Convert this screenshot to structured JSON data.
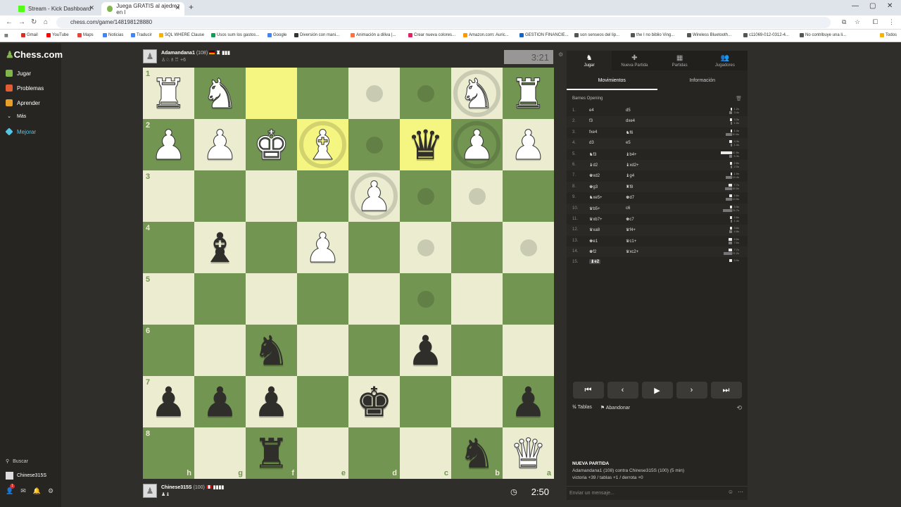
{
  "browser": {
    "tabs": [
      {
        "title": "Stream - Kick Dashboard"
      },
      {
        "title": "Juega GRATIS al ajedrez en l"
      }
    ],
    "url": "chess.com/game/148198128880",
    "bookmarks": [
      "Gmail",
      "YouTube",
      "Maps",
      "Noticias",
      "Traducir",
      "SQL WHERE Clause",
      "Usos sum los gastos...",
      "Google",
      "Diversión con mani...",
      "Animación a diliva |...",
      "Crear nueva colores...",
      "Amazon.com: Auric...",
      "GESTION FINANCIE...",
      "son senseos del lip...",
      "the I no biblio Ving...",
      "Wireless Bluetooth...",
      "c11069-012-0312-4...",
      "No contribuye una li...",
      "Todos"
    ]
  },
  "sidebar": {
    "logo": "Chess.com",
    "items": [
      "Jugar",
      "Problemas",
      "Aprender",
      "Más",
      "Mejorar"
    ],
    "colors": [
      "#81b64c",
      "#e25d33",
      "#e69f28",
      "#bbbbbb",
      "#54c6e3"
    ],
    "bottom": [
      "Buscar",
      "Chinese315S"
    ],
    "notif": "1"
  },
  "top_player": {
    "name": "Adamandana1",
    "rating": "(108)",
    "extra": "+6",
    "clock": "3:21"
  },
  "bottom_player": {
    "name": "Chinese315S",
    "rating": "(100)",
    "clock": "2:50"
  },
  "board": {
    "ranks": [
      "1",
      "2",
      "3",
      "4",
      "5",
      "6",
      "7",
      "8"
    ],
    "files": [
      "h",
      "g",
      "f",
      "e",
      "d",
      "c",
      "b",
      "a"
    ],
    "squares": [
      [
        "wR",
        "wN",
        "hl",
        "",
        "dot",
        "dot",
        "wN+ring",
        "wR"
      ],
      [
        "wP",
        "wP",
        "wK",
        "wB+hl+ring",
        "dot",
        "bQ+hl",
        "wP+ring",
        "wP"
      ],
      [
        "",
        "",
        "",
        "",
        "wP+ring",
        "dot",
        "dot",
        ""
      ],
      [
        "",
        "bB",
        "",
        "wP",
        "",
        "dot",
        "",
        "dot"
      ],
      [
        "",
        "",
        "",
        "",
        "",
        "dot",
        "",
        ""
      ],
      [
        "",
        "",
        "bN",
        "",
        "",
        "bP",
        "",
        ""
      ],
      [
        "bP",
        "bP",
        "bP",
        "",
        "bK",
        "",
        "",
        "bP"
      ],
      [
        "",
        "",
        "bR",
        "",
        "",
        "",
        "bN",
        "wQ"
      ]
    ]
  },
  "panel": {
    "tabs": [
      {
        "label": "Jugar",
        "icon": "♞"
      },
      {
        "label": "Nueva Partida",
        "icon": "✚"
      },
      {
        "label": "Partidas",
        "icon": "▦"
      },
      {
        "label": "Jugadores",
        "icon": "👥"
      }
    ],
    "subtabs": [
      "Movimientos",
      "Información"
    ],
    "opening": "Barnes Opening",
    "moves": [
      {
        "n": "1.",
        "w": "e4",
        "b": "d5",
        "t1": "1.2s",
        "t2": "3.4s",
        "p1": 2,
        "p2": 4
      },
      {
        "n": "2.",
        "w": "f3",
        "b": "dxe4",
        "t1": "3.3s",
        "t2": "1.5s",
        "p1": 3,
        "p2": 2
      },
      {
        "n": "3.",
        "w": "fxe4",
        "b": "♞f6",
        "t1": "1.4s",
        "t2": "10.6s",
        "p1": 2,
        "p2": 9
      },
      {
        "n": "4.",
        "w": "d3",
        "b": "e5",
        "t1": "4.3s",
        "t2": "1.4s",
        "p1": 4,
        "p2": 2
      },
      {
        "n": "5.",
        "w": "♞f3",
        "b": "♝b4+",
        "t1": "42.8s",
        "t2": "5.3s",
        "p1": 16,
        "p2": 4
      },
      {
        "n": "6.",
        "w": "♝d2",
        "b": "♝xd2+",
        "t1": "2.8s",
        "t2": "2.0s",
        "p1": 3,
        "p2": 2
      },
      {
        "n": "7.",
        "w": "♚xd2",
        "b": "♝g4",
        "t1": "1.9s",
        "t2": "13.4s",
        "p1": 2,
        "p2": 9
      },
      {
        "n": "8.",
        "w": "♚g3",
        "b": "♜f8",
        "t1": "7.7s",
        "t2": "16.0s",
        "p1": 5,
        "p2": 10
      },
      {
        "n": "9.",
        "w": "♞xe5+",
        "b": "♚d7",
        "t1": "5.8s",
        "t2": "13.5s",
        "p1": 4,
        "p2": 9
      },
      {
        "n": "10.",
        "w": "♛b5+",
        "b": "c6",
        "t1": "3.9s",
        "t2": "24.7s",
        "p1": 3,
        "p2": 13
      },
      {
        "n": "11.",
        "w": "♛xb7+",
        "b": "♚c7",
        "t1": "2.6s",
        "t2": "1.4s",
        "p1": 3,
        "p2": 2
      },
      {
        "n": "12.",
        "w": "♛xa8",
        "b": "♛f4+",
        "t1": "3.6s",
        "t2": "4.8s",
        "p1": 3,
        "p2": 4
      },
      {
        "n": "13.",
        "w": "♚e1",
        "b": "♛c1+",
        "t1": "8.8s",
        "t2": "7.6s",
        "p1": 5,
        "p2": 5
      },
      {
        "n": "14.",
        "w": "♚f2",
        "b": "♛xc2+",
        "t1": "7.7s",
        "t2": "21.2s",
        "p1": 5,
        "p2": 12
      },
      {
        "n": "15.",
        "w": "♝e2",
        "b": "",
        "t1": "5.9s",
        "t2": "",
        "p1": 4,
        "p2": 0
      }
    ],
    "controls": [
      "⏮",
      "‹",
      "▶",
      "›",
      "⏭"
    ],
    "actions": [
      "Tablas",
      "Abandonar"
    ],
    "newgame": {
      "title": "NUEVA PARTIDA",
      "line1": "Adamandana1 (108) contra Chinese315S (100) (5 min)",
      "line2": "victoria +39 / tablas +1 / derrota +0"
    },
    "chat_placeholder": "Enviar un mensaje..."
  }
}
